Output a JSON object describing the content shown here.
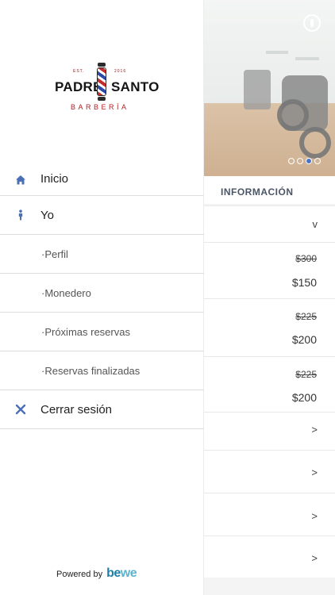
{
  "drawer": {
    "logo": {
      "est_left": "EST.",
      "est_right": "2016",
      "word_left": "PADRE",
      "word_right": "SANTO",
      "subtitle": "BARBERÍA"
    },
    "menu": [
      {
        "label": "Inicio",
        "icon": "home-icon"
      },
      {
        "label": "Yo",
        "icon": "person-icon"
      },
      {
        "label": "·Perfil"
      },
      {
        "label": "·Monedero"
      },
      {
        "label": "·Próximas reservas"
      },
      {
        "label": "·Reservas finalizadas"
      },
      {
        "label": "Cerrar sesión",
        "icon": "close-icon"
      }
    ],
    "powered_by": "Powered by",
    "brand": {
      "part1": "be",
      "part2": "we"
    }
  },
  "background": {
    "info_header": "INFORMACIÓN",
    "collapse_chevron": "v",
    "services": [
      {
        "old_price": "$300",
        "new_price": "$150"
      },
      {
        "old_price": "$225",
        "new_price": "$200"
      },
      {
        "old_price": "$225",
        "new_price": "$200"
      }
    ],
    "row_chevrons": [
      ">",
      ">",
      ">",
      ">"
    ]
  },
  "colors": {
    "accent": "#4a6fb5",
    "brand_red": "#b01f24",
    "bewe_blue": "#1e7ea8"
  }
}
